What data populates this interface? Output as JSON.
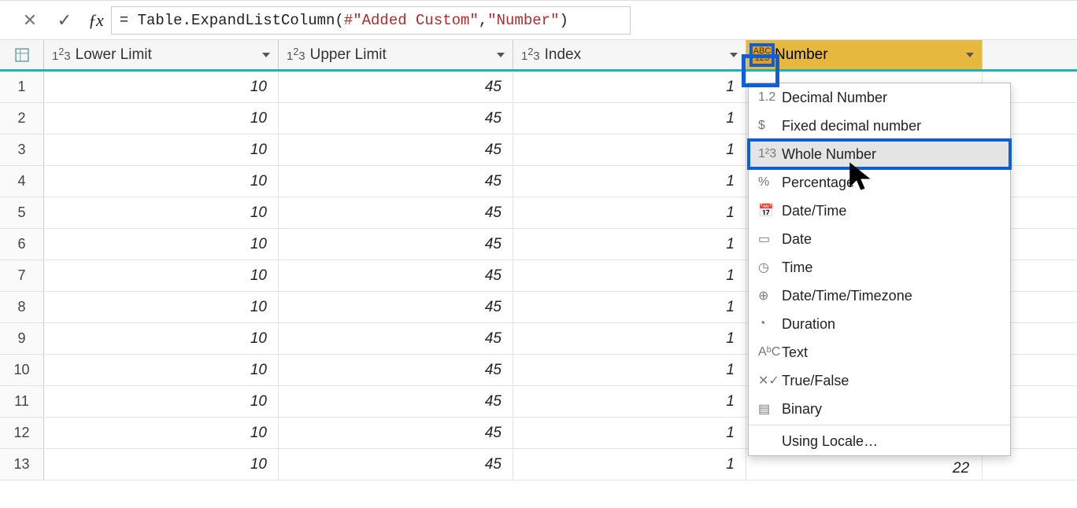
{
  "formula": {
    "prefix": "= Table.ExpandListColumn(",
    "arg1": "#\"Added Custom\"",
    "mid": ", ",
    "arg2": "\"Number\"",
    "suffix": ")"
  },
  "columns": {
    "c1": "Lower Limit",
    "c2": "Upper Limit",
    "c3": "Index",
    "c4": "Number",
    "type_prefix_num": "1²3",
    "type_prefix_any": "ABC\n123"
  },
  "rows": [
    {
      "n": "1",
      "lower": "10",
      "upper": "45",
      "index": "1"
    },
    {
      "n": "2",
      "lower": "10",
      "upper": "45",
      "index": "1"
    },
    {
      "n": "3",
      "lower": "10",
      "upper": "45",
      "index": "1"
    },
    {
      "n": "4",
      "lower": "10",
      "upper": "45",
      "index": "1"
    },
    {
      "n": "5",
      "lower": "10",
      "upper": "45",
      "index": "1"
    },
    {
      "n": "6",
      "lower": "10",
      "upper": "45",
      "index": "1"
    },
    {
      "n": "7",
      "lower": "10",
      "upper": "45",
      "index": "1"
    },
    {
      "n": "8",
      "lower": "10",
      "upper": "45",
      "index": "1"
    },
    {
      "n": "9",
      "lower": "10",
      "upper": "45",
      "index": "1"
    },
    {
      "n": "10",
      "lower": "10",
      "upper": "45",
      "index": "1"
    },
    {
      "n": "11",
      "lower": "10",
      "upper": "45",
      "index": "1"
    },
    {
      "n": "12",
      "lower": "10",
      "upper": "45",
      "index": "1"
    },
    {
      "n": "13",
      "lower": "10",
      "upper": "45",
      "index": "1"
    }
  ],
  "extra_value": "22",
  "menu": {
    "items": [
      {
        "icon": "1.2",
        "label": "Decimal Number"
      },
      {
        "icon": "$",
        "label": "Fixed decimal number"
      },
      {
        "icon": "1²3",
        "label": "Whole Number"
      },
      {
        "icon": "%",
        "label": "Percentage"
      },
      {
        "icon": "📅",
        "label": "Date/Time"
      },
      {
        "icon": "▭",
        "label": "Date"
      },
      {
        "icon": "◷",
        "label": "Time"
      },
      {
        "icon": "⊕",
        "label": "Date/Time/Timezone"
      },
      {
        "icon": "◔",
        "label": "Duration"
      },
      {
        "icon": "AᵇC",
        "label": "Text"
      },
      {
        "icon": "✕✓",
        "label": "True/False"
      },
      {
        "icon": "▤",
        "label": "Binary"
      },
      {
        "icon": "",
        "label": "Using Locale…"
      }
    ],
    "highlight_index": 2
  }
}
